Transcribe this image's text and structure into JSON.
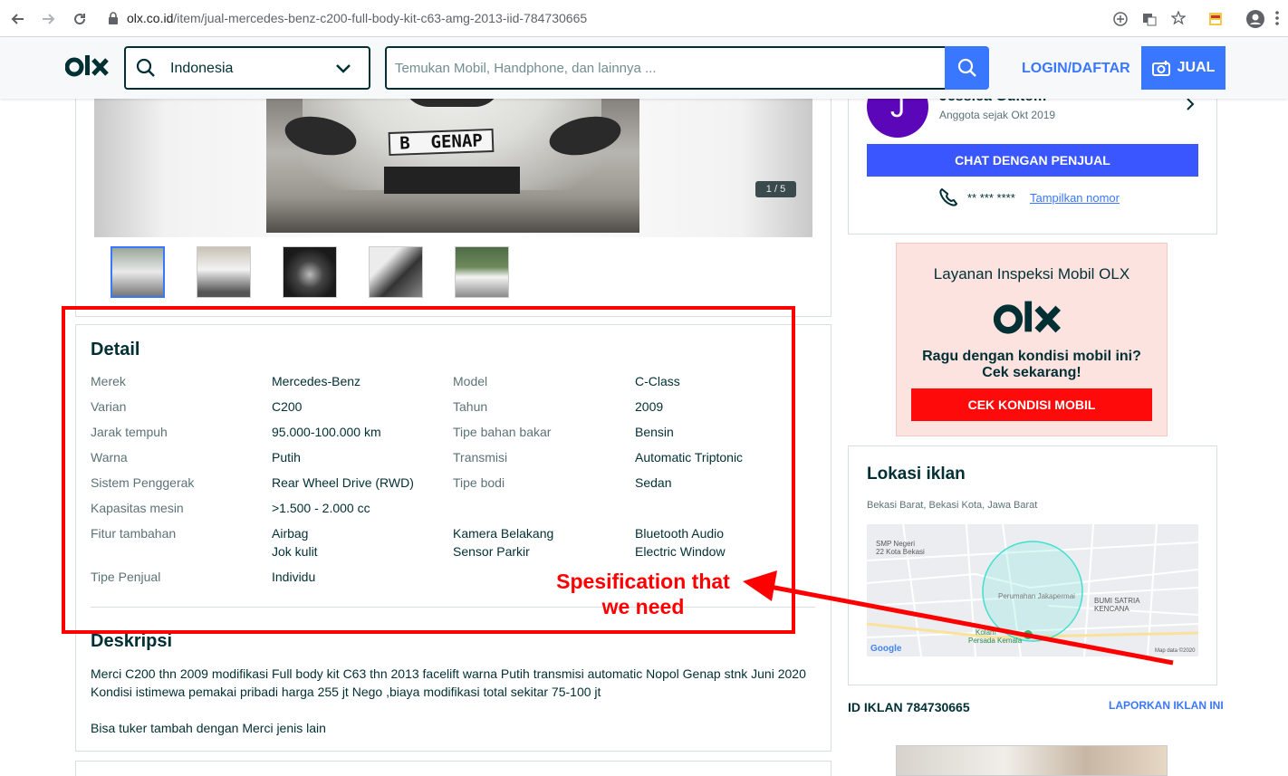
{
  "browser": {
    "url_host": "olx.co.id",
    "url_path": "/item/jual-mercedes-benz-c200-full-body-kit-c63-amg-2013-iid-784730665"
  },
  "header": {
    "logo": "olx",
    "location_value": "Indonesia",
    "search_placeholder": "Temukan Mobil, Handphone, dan lainnya ...",
    "login_label": "LOGIN/DAFTAR",
    "sell_label": "JUAL"
  },
  "gallery": {
    "plate_text": "B  GENAP",
    "counter": "1 / 5",
    "thumbnail_count": 5
  },
  "detail": {
    "heading": "Detail",
    "rows": [
      {
        "l1": "Merek",
        "v1": "Mercedes-Benz",
        "l2": "Model",
        "v2": "C-Class"
      },
      {
        "l1": "Varian",
        "v1": "C200",
        "l2": "Tahun",
        "v2": "2009"
      },
      {
        "l1": "Jarak tempuh",
        "v1": "95.000-100.000 km",
        "l2": "Tipe bahan bakar",
        "v2": "Bensin"
      },
      {
        "l1": "Warna",
        "v1": "Putih",
        "l2": "Transmisi",
        "v2": "Automatic Triptonic"
      },
      {
        "l1": "Sistem Penggerak",
        "v1": "Rear Wheel Drive (RWD)",
        "l2": "Tipe bodi",
        "v2": "Sedan"
      },
      {
        "l1": "Kapasitas mesin",
        "v1": ">1.500 - 2.000 cc",
        "l2": "",
        "v2": ""
      }
    ],
    "features_label": "Fitur tambahan",
    "features": [
      "Airbag",
      "Jok kulit",
      "Kamera Belakang",
      "Sensor Parkir",
      "Bluetooth Audio",
      "Electric Window"
    ],
    "seller_type_label": "Tipe Penjual",
    "seller_type_value": "Individu"
  },
  "description": {
    "heading": "Deskripsi",
    "line1": "Merci C200 thn 2009 modifikasi Full body kit C63 thn 2013 facelift warna Putih transmisi automatic Nopol Genap stnk Juni 2020",
    "line2": "Kondisi istimewa pemakai pribadi harga 255 jt Nego ,biaya modifikasi total sekitar 75-100 jt",
    "line3": "Bisa tuker tambah dengan Merci jenis lain"
  },
  "annotation": {
    "line1": "Spesification that",
    "line2": "we need",
    "color": "#ff0000"
  },
  "seller": {
    "initial": "J",
    "name": "Jessica Gultom",
    "member_since": "Anggota sejak Okt 2019",
    "chat_label": "CHAT DENGAN PENJUAL",
    "phone_masked": "** *** ****",
    "show_number": "Tampilkan nomor"
  },
  "inspection": {
    "title": "Layanan Inspeksi Mobil OLX",
    "logo": "olx",
    "question1": "Ragu dengan kondisi mobil ini?",
    "question2": "Cek sekarang!",
    "button": "CEK KONDISI MOBIL"
  },
  "location": {
    "heading": "Lokasi iklan",
    "address": "Bekasi Barat, Bekasi Kota, Jawa Barat",
    "map_labels": {
      "smp": "SMP Negeri",
      "smp2": "22 Kota Bekasi",
      "perumahan": "Perumahan Jakapermai",
      "bumi1": "BUMI SATRIA",
      "bumi2": "KENCANA",
      "kolam1": "Kolam",
      "kolam2": "Persada Kemala",
      "google": "Google",
      "mapdata": "Map data ©2020"
    }
  },
  "ad": {
    "id_label": "ID IKLAN 784730665",
    "report_label": "LAPORKAN IKLAN INI"
  },
  "colors": {
    "brand": "#002f34",
    "accent_blue": "#3a77ff",
    "chat_blue": "#3a56ff",
    "red_button": "#ff0a0a",
    "avatar": "#5b06b8"
  }
}
